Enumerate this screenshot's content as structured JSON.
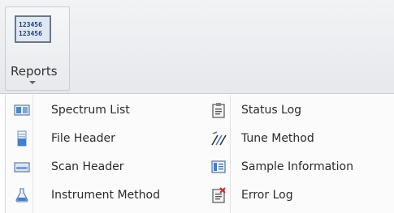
{
  "ribbon": {
    "reports_button": {
      "label": "Reports",
      "glyph_lines": [
        "123456",
        "123456"
      ]
    }
  },
  "menu": {
    "left": [
      {
        "label": "Spectrum List",
        "icon": "spectrum-list-icon"
      },
      {
        "label": "File Header",
        "icon": "file-header-icon"
      },
      {
        "label": "Scan Header",
        "icon": "scan-header-icon"
      },
      {
        "label": "Instrument Method",
        "icon": "instrument-method-icon"
      }
    ],
    "right": [
      {
        "label": "Status Log",
        "icon": "status-log-icon"
      },
      {
        "label": "Tune Method",
        "icon": "tune-method-icon"
      },
      {
        "label": "Sample Information",
        "icon": "sample-information-icon"
      },
      {
        "label": "Error Log",
        "icon": "error-log-icon"
      }
    ]
  },
  "colors": {
    "accent_blue": "#2f6fbf",
    "error_red": "#d22b2b"
  }
}
